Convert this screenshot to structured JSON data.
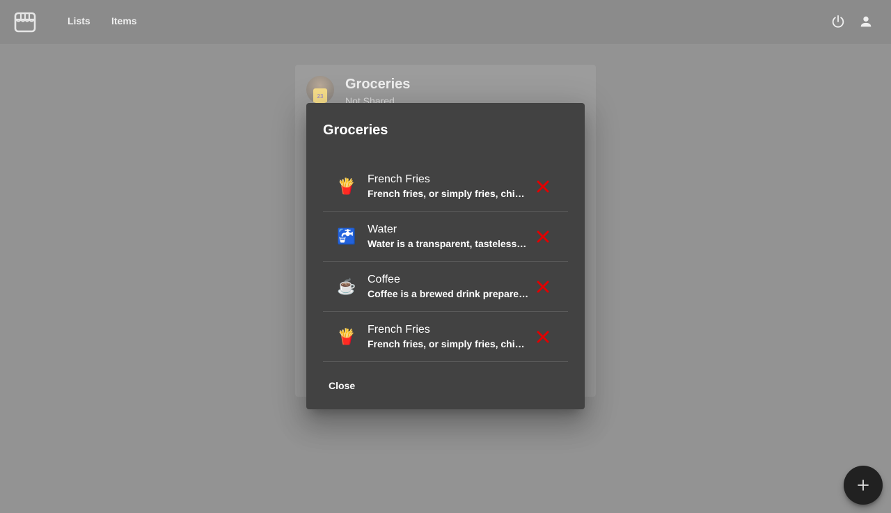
{
  "nav": {
    "lists_label": "Lists",
    "items_label": "Items"
  },
  "list_card": {
    "title": "Groceries",
    "subtitle": "Not Shared",
    "avatar_jersey_number": "23"
  },
  "dialog": {
    "title": "Groceries",
    "items": [
      {
        "emoji": "🍟",
        "name": "French Fries",
        "description": "French fries, or simply fries, chips, finger chips, or French-fried potatoes"
      },
      {
        "emoji": "🚰",
        "name": "Water",
        "description": "Water is a transparent, tasteless, odorless, and nearly colorless substance"
      },
      {
        "emoji": "☕",
        "name": "Coffee",
        "description": "Coffee is a brewed drink prepared from roasted coffee beans"
      },
      {
        "emoji": "🍟",
        "name": "French Fries",
        "description": "French fries, or simply fries, chips, finger chips, or French-fried potatoes"
      }
    ],
    "close_label": "Close"
  },
  "icons": {
    "logo": "storefront-icon",
    "power": "power-icon",
    "account": "account-icon",
    "delete": "close-x-icon",
    "fab": "plus-icon"
  },
  "colors": {
    "appbar": "#212121",
    "dialog_bg": "#424242",
    "delete_red": "#e00000"
  }
}
